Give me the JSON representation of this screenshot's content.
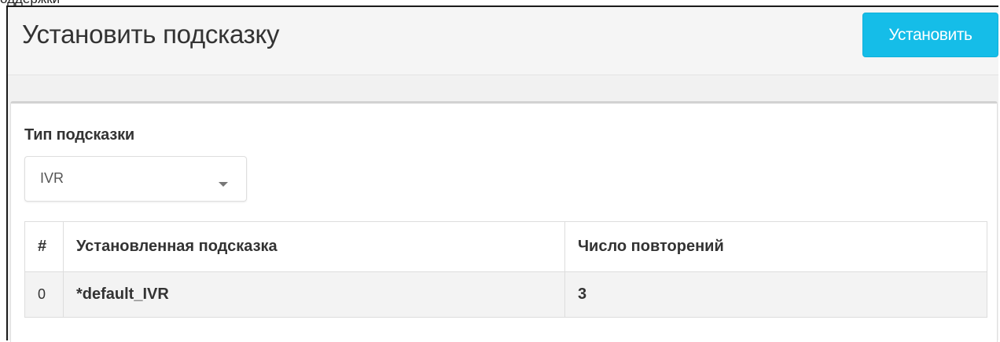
{
  "page": {
    "title": "Установить подсказку",
    "set_button_label": "Установить"
  },
  "form": {
    "prompt_type_label": "Тип подсказки",
    "prompt_type_value": "IVR",
    "prompt_type_icon": "chevron-down-icon"
  },
  "table": {
    "headers": [
      "#",
      "Установленная подсказка",
      "Число повторений"
    ],
    "rows": [
      {
        "index": "0",
        "prompt": "*default_IVR",
        "repeat_count": "3"
      }
    ]
  },
  "colors": {
    "accent": "#15bde8",
    "header_bg": "#f5f5f5",
    "row_alt_bg": "#f3f3f3"
  }
}
